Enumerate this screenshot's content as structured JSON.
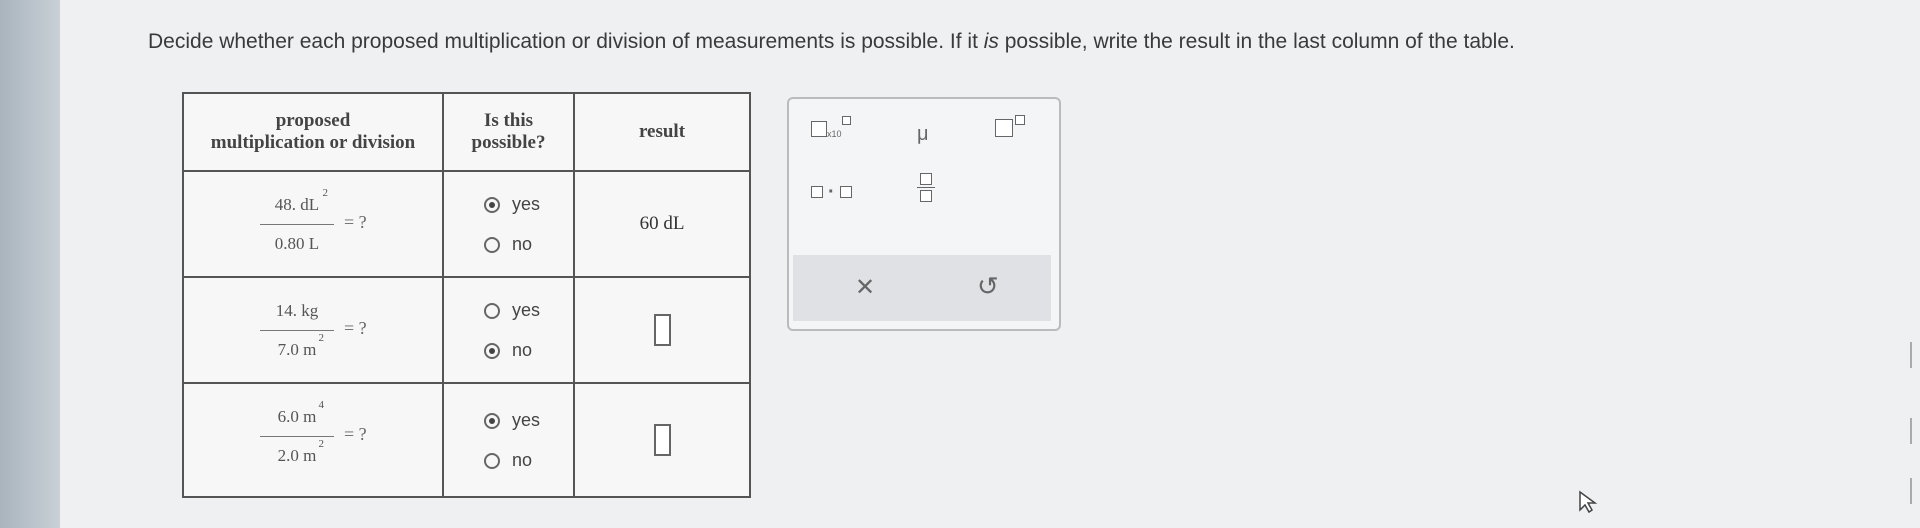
{
  "instructions": {
    "pre": "Decide whether each proposed multiplication or division of measurements is possible. If it ",
    "em": "is",
    "post": " possible, write the result in the last column of the table."
  },
  "table": {
    "headers": {
      "col1_line1": "proposed",
      "col1_line2": "multiplication or division",
      "col2_line1": "Is this",
      "col2_line2": "possible?",
      "col3": "result"
    },
    "rows": [
      {
        "num": "48. dL",
        "num_exp": "2",
        "den": "0.80 L",
        "den_exp": "",
        "eq": "= ?",
        "yes": "yes",
        "no": "no",
        "selected": "yes",
        "result": "60 dL"
      },
      {
        "num": "14. kg",
        "num_exp": "",
        "den": "7.0 m",
        "den_exp": "2",
        "eq": "= ?",
        "yes": "yes",
        "no": "no",
        "selected": "no",
        "result": ""
      },
      {
        "num": "6.0 m",
        "num_exp": "4",
        "den": "2.0 m",
        "den_exp": "2",
        "eq": "= ?",
        "yes": "yes",
        "no": "no",
        "selected": "yes",
        "result": ""
      }
    ]
  },
  "toolbox": {
    "x10_label": "x10",
    "mu_label": "μ",
    "dot_label": "·",
    "clear_symbol": "✕",
    "undo_symbol": "↺"
  },
  "icons": {
    "cursor": "pointer-cursor-icon"
  }
}
